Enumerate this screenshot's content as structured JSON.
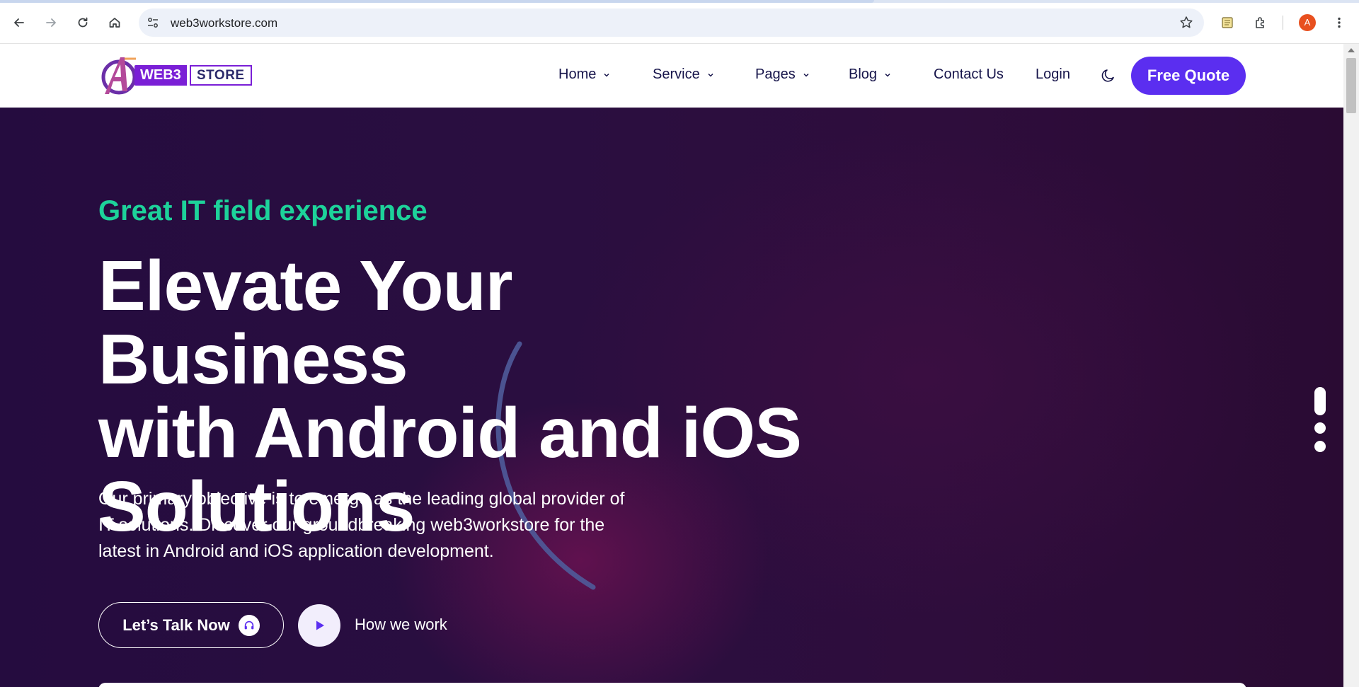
{
  "browser": {
    "url": "web3workstore.com",
    "profile_initial": "A",
    "icons": [
      "back-icon",
      "forward-icon",
      "reload-icon",
      "home-icon",
      "site-settings-icon",
      "bookmark-star-icon",
      "notes-icon",
      "extensions-icon",
      "menu-kebab-icon"
    ]
  },
  "header": {
    "logo": {
      "word1": "WEB3",
      "word2": "STORE"
    },
    "nav": [
      {
        "label": "Home",
        "dropdown": true
      },
      {
        "label": "Service",
        "dropdown": true
      },
      {
        "label": "Pages",
        "dropdown": true
      },
      {
        "label": "Blog",
        "dropdown": true
      },
      {
        "label": "Contact Us",
        "dropdown": false
      },
      {
        "label": "Login",
        "dropdown": false
      }
    ],
    "theme_icon": "moon-icon",
    "cta_label": "Free Quote"
  },
  "hero": {
    "eyebrow": "Great IT field experience",
    "headline_line1": "Elevate Your Business",
    "headline_line2": "with Android and iOS",
    "headline_line3": "Solutions",
    "description": "Our primary objective is to emerge as the leading global provider of IT solutions. Discover our groundbreaking web3workstore for the latest in Android and iOS application development.",
    "talk_label": "Let’s Talk Now",
    "how_label": "How we work"
  },
  "colors": {
    "accent": "#5b2ef0",
    "eyebrow": "#1dd29a",
    "hero_bg": "#2a0e40",
    "nav_text": "#16144a",
    "logo_purple": "#7a1fd6"
  }
}
